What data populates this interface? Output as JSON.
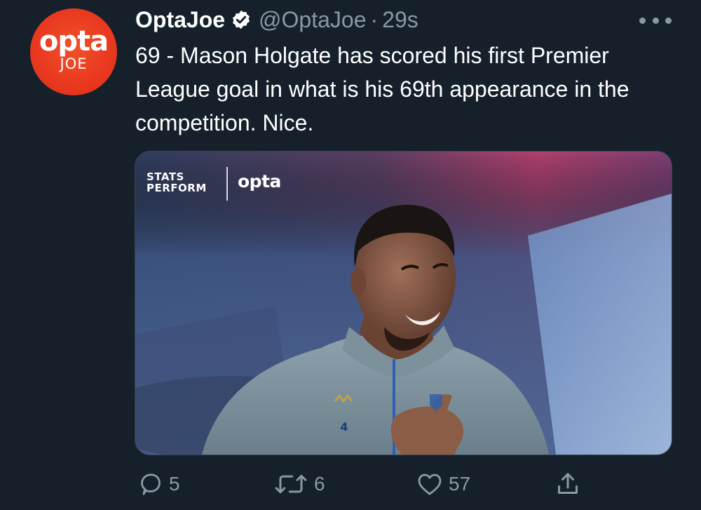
{
  "tweet": {
    "avatar": {
      "brand": "opta",
      "sub": "JOE",
      "color": "#e8381f"
    },
    "display_name": "OptaJoe",
    "verified_icon": "verified-badge-icon",
    "handle": "@OptaJoe",
    "separator": "·",
    "time": "29s",
    "text": "69 - Mason Holgate has scored his first Premier League goal in what is his 69th appearance in the competition. Nice.",
    "media": {
      "logo_stats_line1": "STATS",
      "logo_stats_line2": "PERFORM",
      "logo_opta": "opta",
      "shirt_number": "4"
    },
    "actions": {
      "reply_count": "5",
      "retweet_count": "6",
      "like_count": "57"
    }
  },
  "colors": {
    "background": "#15202b",
    "secondary_text": "#8899a6",
    "accent": "#e8381f"
  }
}
